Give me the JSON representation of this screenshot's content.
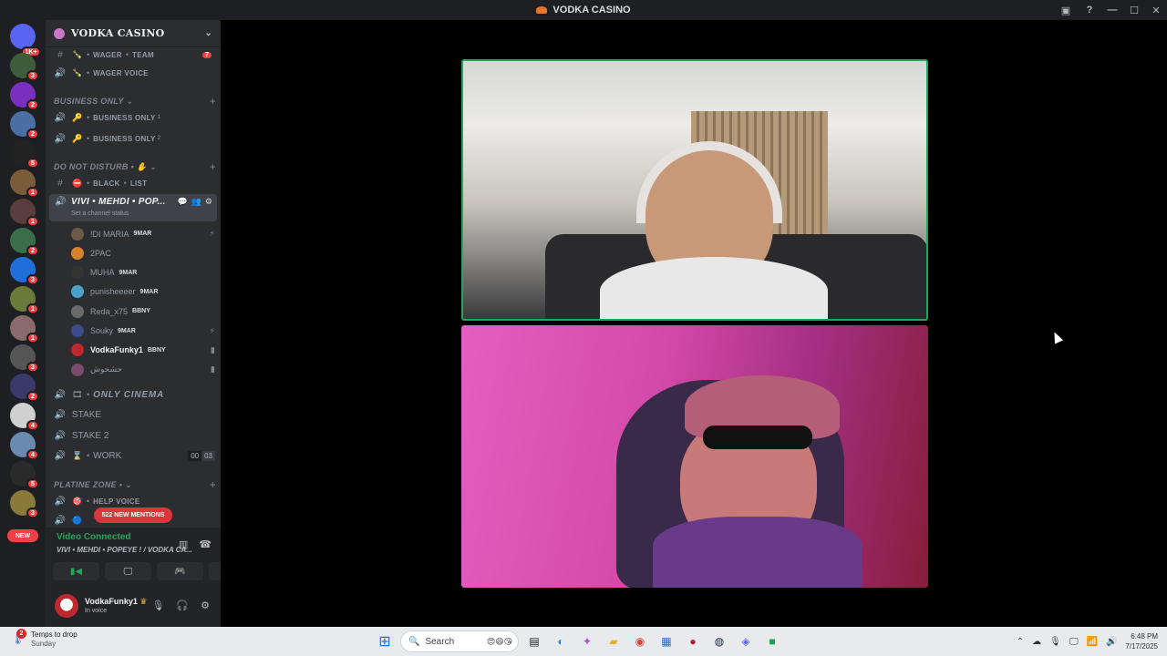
{
  "window": {
    "title": "VODKA CASINO"
  },
  "guilds": [
    {
      "badge": "1K+",
      "color": "#5865f2"
    },
    {
      "badge": "3",
      "color": "#3d5c3a"
    },
    {
      "badge": "2",
      "color": "#7b2fbe"
    },
    {
      "badge": "2",
      "color": "#4a6fa5"
    },
    {
      "badge": "5",
      "color": "#222222"
    },
    {
      "badge": "1",
      "color": "#7a5c3a"
    },
    {
      "badge": "1",
      "color": "#5a3d3d"
    },
    {
      "badge": "2",
      "color": "#3a6e4a"
    },
    {
      "badge": "3",
      "color": "#1e6fd9"
    },
    {
      "badge": "1",
      "color": "#6a7a3a"
    },
    {
      "badge": "1",
      "color": "#8a6a6a"
    },
    {
      "badge": "3",
      "color": "#555555"
    },
    {
      "badge": "2",
      "color": "#3a3a6a"
    },
    {
      "badge": "4",
      "color": "#d0d0d0"
    },
    {
      "badge": "4",
      "color": "#6a8ab0"
    },
    {
      "badge": "5",
      "color": "#2a2a2a"
    },
    {
      "badge": "3",
      "color": "#8a7a3a"
    }
  ],
  "new_pill": "NEW",
  "server": {
    "name": "VODKA CASINO"
  },
  "channels": {
    "wager_team": {
      "label": "WAGER",
      "label2": "TEAM",
      "badge": "7"
    },
    "wager_voice": {
      "label": "WAGER VOICE"
    },
    "cat_business": "BUSINESS ONLY",
    "business1": {
      "label": "BUSINESS ONLY",
      "sup": "1"
    },
    "business2": {
      "label": "BUSINESS ONLY",
      "sup": "2"
    },
    "cat_dnd": "DO NOT DISTURB",
    "blacklist": {
      "label": "BLACK",
      "label2": "LIST"
    },
    "active": {
      "name": "VIVI • MEHDI • POP...",
      "status": "Set a channel status"
    },
    "only_cinema": {
      "label": "ONLY CINEMA"
    },
    "stake": {
      "label": "STAKE"
    },
    "stake2": {
      "label": "STAKE 2"
    },
    "work": {
      "label": "WORK",
      "count_a": "00",
      "count_b": "03"
    },
    "cat_platine": "PLATINE ZONE",
    "help_voice": {
      "label": "HELP VOICE"
    }
  },
  "voice_users": [
    {
      "name": "!DI MARIA",
      "tag": "9MAR",
      "color": "#6b5a4a"
    },
    {
      "name": "2PAC",
      "tag": "",
      "color": "#d9822b"
    },
    {
      "name": "MUHA",
      "tag": "9MAR",
      "color": "#333333"
    },
    {
      "name": "punisheeeer",
      "tag": "9MAR",
      "color": "#4aa0c8"
    },
    {
      "name": "Reda_x75",
      "tag": "BBNY",
      "color": "#6a6a6a"
    },
    {
      "name": "Souky",
      "tag": "9MAR",
      "color": "#3a4a8a"
    },
    {
      "name": "VodkaFunky1",
      "tag": "BBNY",
      "color": "#c0282f"
    },
    {
      "name": "حشحوش",
      "tag": "",
      "color": "#7a4a6a"
    }
  ],
  "mentions": "522 NEW MENTIONS",
  "voice_panel": {
    "status": "Video Connected",
    "channel": "VIVI • MEHDI • POPEYE ! / VODKA CA..."
  },
  "user": {
    "name": "VodkaFunky1",
    "status": "In voice"
  },
  "taskbar": {
    "weather_title": "Temps to drop",
    "weather_day": "Sunday",
    "weather_badge": "2",
    "search_label": "Search",
    "time": "6:48 PM",
    "date": "7/17/2025"
  }
}
